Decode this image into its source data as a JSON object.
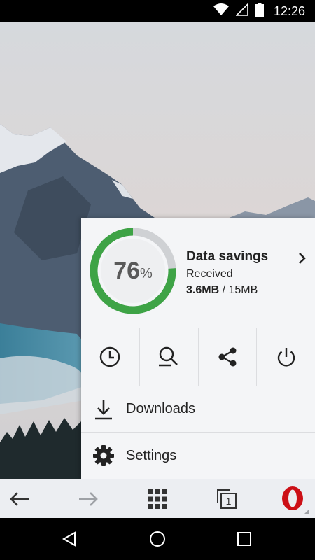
{
  "status_bar": {
    "time": "12:26",
    "icons": [
      "wifi-icon",
      "signal-icon",
      "battery-icon"
    ]
  },
  "data_savings": {
    "percent": 76,
    "percent_number": "76",
    "percent_symbol": "%",
    "title": "Data savings",
    "subtitle": "Received",
    "received": "3.6MB",
    "separator": " / ",
    "total": "15MB"
  },
  "quick_actions": [
    {
      "icon": "history-clock-icon"
    },
    {
      "icon": "find-in-page-icon"
    },
    {
      "icon": "share-icon"
    },
    {
      "icon": "power-exit-icon"
    }
  ],
  "menu": {
    "downloads_label": "Downloads",
    "settings_label": "Settings"
  },
  "toolbar": {
    "icons": [
      "back-arrow-icon",
      "forward-arrow-icon",
      "speed-dial-grid-icon",
      "tabs-icon",
      "opera-menu-icon"
    ],
    "tab_count": "1"
  },
  "navigation": {
    "icons": [
      "nav-back-icon",
      "nav-home-icon",
      "nav-recents-icon"
    ]
  },
  "colors": {
    "gauge_fill": "#3ea346",
    "gauge_track": "#cfd1d4",
    "opera_red": "#cc0f16"
  }
}
